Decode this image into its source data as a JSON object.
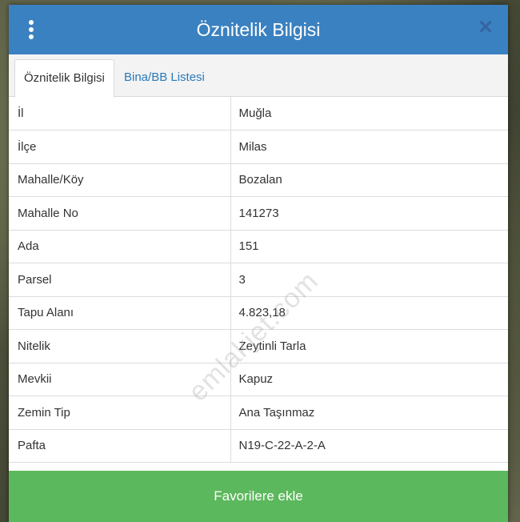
{
  "header": {
    "title": "Öznitelik Bilgisi"
  },
  "tabs": [
    {
      "label": "Öznitelik Bilgisi",
      "active": true
    },
    {
      "label": "Bina/BB Listesi",
      "active": false
    }
  ],
  "rows": [
    {
      "key": "İl",
      "value": "Muğla"
    },
    {
      "key": "İlçe",
      "value": "Milas"
    },
    {
      "key": "Mahalle/Köy",
      "value": "Bozalan"
    },
    {
      "key": "Mahalle No",
      "value": "141273"
    },
    {
      "key": "Ada",
      "value": "151"
    },
    {
      "key": "Parsel",
      "value": "3"
    },
    {
      "key": "Tapu Alanı",
      "value": "4.823,18"
    },
    {
      "key": "Nitelik",
      "value": "Zeytinli Tarla"
    },
    {
      "key": "Mevkii",
      "value": "Kapuz"
    },
    {
      "key": "Zemin Tip",
      "value": "Ana Taşınmaz"
    },
    {
      "key": "Pafta",
      "value": "N19-C-22-A-2-A"
    }
  ],
  "watermark": "emlakjet.com",
  "footer": {
    "button_label": "Favorilere ekle"
  },
  "colors": {
    "header": "#3a81c1",
    "button": "#5cb85c",
    "tab_link": "#2a7ab8"
  },
  "icons": {
    "menu": "more-vertical-icon",
    "close": "close-icon"
  }
}
